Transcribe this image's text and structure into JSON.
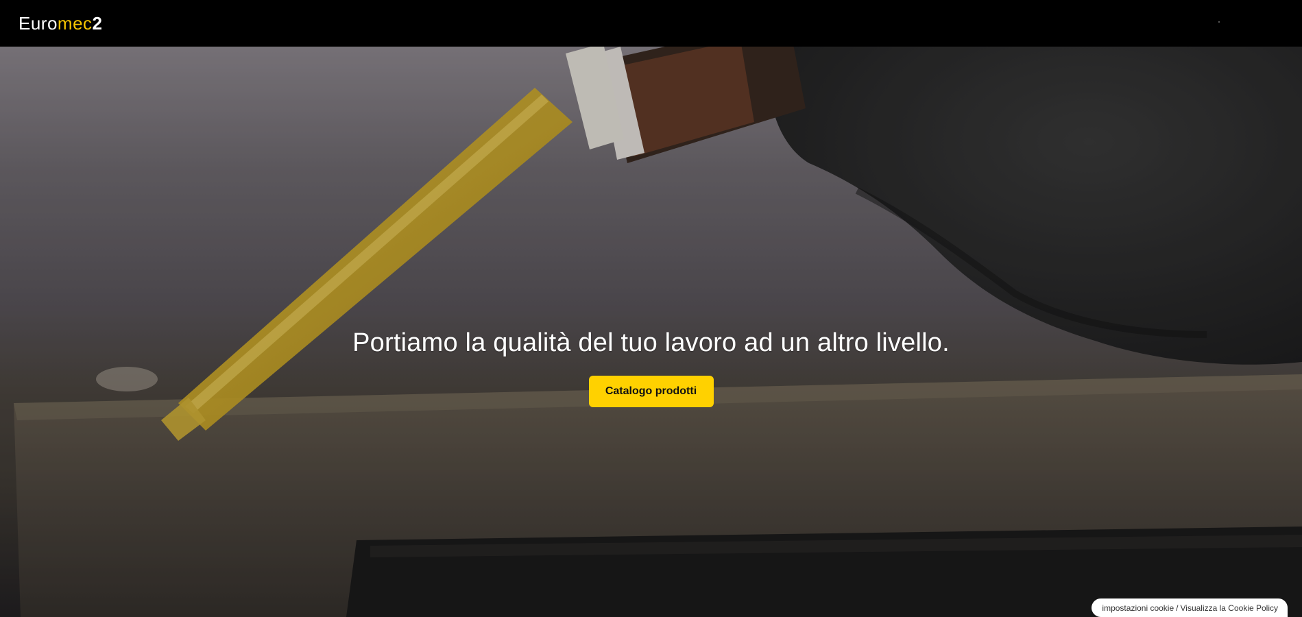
{
  "header": {
    "logo": {
      "part1": "Euro",
      "part2": "mec",
      "part3": "2"
    },
    "colors": {
      "background": "#000000",
      "logo_accent": "#f6c400"
    }
  },
  "hero": {
    "headline": "Portiamo la qualità del tuo lavoro ad un altro livello.",
    "cta_label": "Catalogo prodotti",
    "colors": {
      "cta_background": "#ffd100",
      "cta_text": "#111111"
    }
  },
  "cookie_banner": {
    "settings_label": "impostazioni cookie",
    "separator": "/",
    "policy_label": "Visualizza la Cookie Policy"
  }
}
